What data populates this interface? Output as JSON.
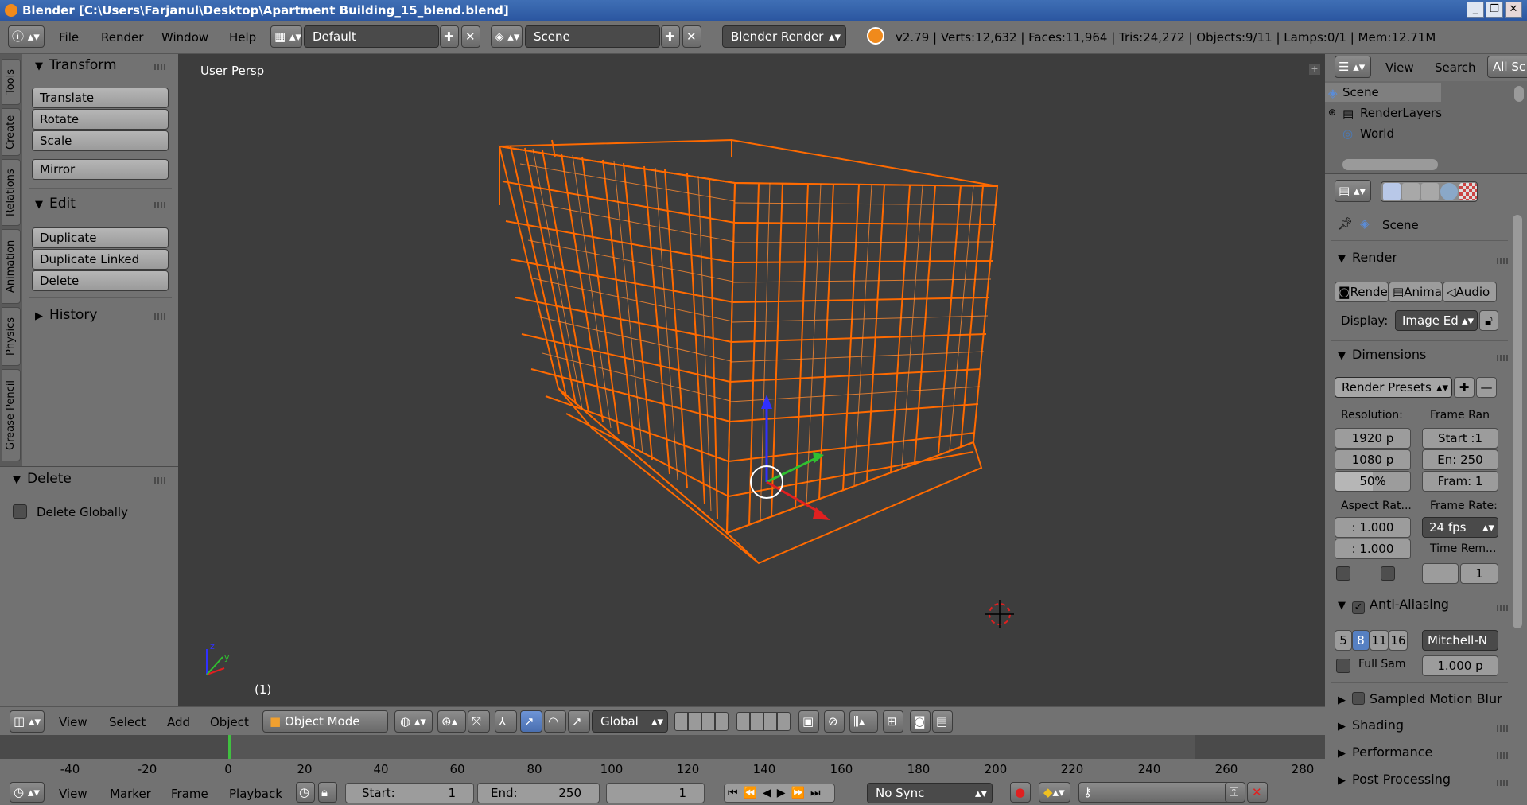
{
  "window": {
    "title": "Blender [C:\\Users\\Farjanul\\Desktop\\Apartment Building_15_blend.blend]"
  },
  "topbar": {
    "menus": [
      "File",
      "Render",
      "Window",
      "Help"
    ],
    "layout": "Default",
    "scene": "Scene",
    "engine": "Blender Render",
    "stats": "v2.79 | Verts:12,632 | Faces:11,964 | Tris:24,272 | Objects:9/11 | Lamps:0/1 | Mem:12.71M"
  },
  "left_tabs": [
    "Tools",
    "Create",
    "Relations",
    "Animation",
    "Physics",
    "Grease Pencil"
  ],
  "toolshelf": {
    "transform_title": "Transform",
    "translate": "Translate",
    "rotate": "Rotate",
    "scale": "Scale",
    "mirror": "Mirror",
    "edit_title": "Edit",
    "duplicate": "Duplicate",
    "duplicate_linked": "Duplicate Linked",
    "delete": "Delete",
    "history_title": "History"
  },
  "operator": {
    "title": "Delete",
    "delete_globally": "Delete Globally"
  },
  "viewport": {
    "label": "User Persp",
    "frame": "(1)"
  },
  "vp_header": {
    "menus": [
      "View",
      "Select",
      "Add",
      "Object"
    ],
    "mode": "Object Mode",
    "orientation": "Global"
  },
  "timeline": {
    "ticks": [
      "-40",
      "-20",
      "0",
      "20",
      "40",
      "60",
      "80",
      "100",
      "120",
      "140",
      "160",
      "180",
      "200",
      "220",
      "240",
      "260",
      "280"
    ],
    "menus": [
      "View",
      "Marker",
      "Frame",
      "Playback"
    ],
    "start_label": "Start:",
    "start": "1",
    "end_label": "End:",
    "end": "250",
    "current": "1",
    "sync": "No Sync"
  },
  "outliner": {
    "view": "View",
    "search": "Search",
    "filter": "All Sc",
    "items": [
      "Scene",
      "RenderLayers",
      "World"
    ]
  },
  "props": {
    "context": "Scene",
    "render_title": "Render",
    "render_btn": "Rende",
    "anim_btn": "Anima",
    "audio_btn": "Audio",
    "display_label": "Display:",
    "display_value": "Image Ed",
    "dimensions_title": "Dimensions",
    "presets": "Render Presets",
    "resolution_label": "Resolution:",
    "res_x": "1920 p",
    "res_y": "1080 p",
    "res_pct": "50%",
    "frame_range_label": "Frame Ran",
    "frame_start": "Start :1",
    "frame_end": "En: 250",
    "frame_step": "Fram: 1",
    "aspect_label": "Aspect Rat...",
    "aspect_x": ": 1.000",
    "aspect_y": ": 1.000",
    "frame_rate_label": "Frame Rate:",
    "frame_rate": "24 fps",
    "time_remap_label": "Time Rem...",
    "time_remap_val": "1",
    "aa_title": "Anti-Aliasing",
    "aa_samples": [
      "5",
      "8",
      "11",
      "16"
    ],
    "aa_filter": "Mitchell-N",
    "full_sample": "Full Sam",
    "filter_size": "1.000 p",
    "motion_blur": "Sampled Motion Blur",
    "shading": "Shading",
    "performance": "Performance",
    "post_processing": "Post Processing"
  },
  "colors": {
    "wire": "#ff6a00",
    "viewport_bg": "#3d3d3d",
    "panel": "#727272",
    "accent_blue": "#5680c2"
  }
}
